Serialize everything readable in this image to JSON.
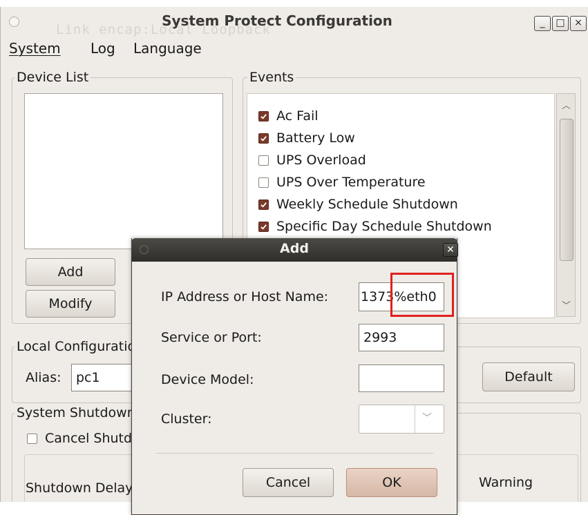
{
  "window": {
    "title": "System Protect Configuration",
    "ghost_text": "Link encap:Local Loopback",
    "minimize": "_",
    "maximize": "□",
    "close": "×"
  },
  "menu": {
    "system": "System",
    "log": "Log",
    "language": "Language"
  },
  "device_list": {
    "label": "Device List",
    "add_label": "Add",
    "modify_label": "Modify"
  },
  "events": {
    "label": "Events",
    "items": [
      {
        "label": "Ac Fail",
        "checked": true
      },
      {
        "label": "Battery Low",
        "checked": true
      },
      {
        "label": "UPS Overload",
        "checked": false
      },
      {
        "label": "UPS Over Temperature",
        "checked": false
      },
      {
        "label": "Weekly Schedule Shutdown",
        "checked": true
      },
      {
        "label": "Specific Day Schedule Shutdown",
        "checked": true
      }
    ]
  },
  "local_config": {
    "label": "Local Configuration",
    "alias_label": "Alias:",
    "alias_value": "pc1",
    "default_label": "Default"
  },
  "system_shutdown": {
    "label": "System Shutdown",
    "cancel_label": "Cancel Shutdown",
    "delay_label": "Shutdown Delay",
    "warning_label": "Warning"
  },
  "dialog": {
    "title": "Add",
    "ip_label": "IP Address or Host Name:",
    "ip_value": "1373%eth0",
    "port_label": "Service or Port:",
    "port_value": "2993",
    "model_label": "Device Model:",
    "model_value": "",
    "cluster_label": "Cluster:",
    "cluster_value": "",
    "cancel_label": "Cancel",
    "ok_label": "OK"
  },
  "colors": {
    "window_bg": "#efebe6",
    "dialog_title_bg": "#3a3935",
    "checkbox_checked": "#7a3a2a",
    "highlight": "#e02020"
  }
}
